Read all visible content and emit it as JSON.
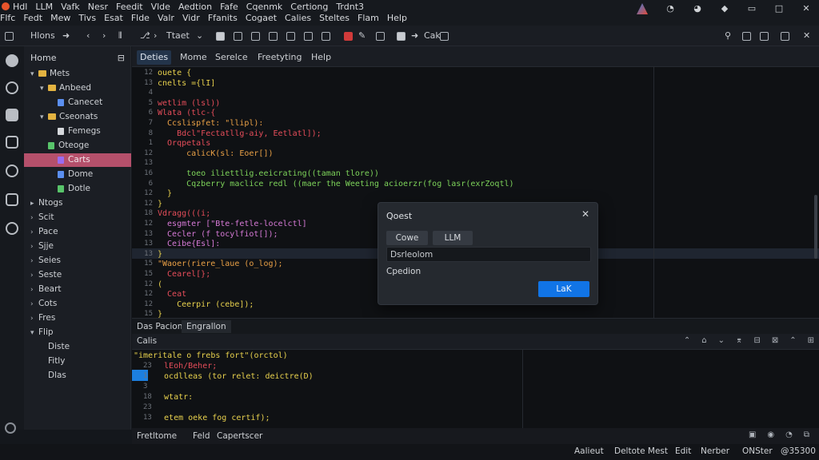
{
  "menu": {
    "row1": [
      "Hdl",
      "LLM",
      "Vafk",
      "Nesr",
      "Feedit",
      "Vlde",
      "Aedtion",
      "Fafe",
      "Cqenmk",
      "Certiong",
      "Trdnt3"
    ],
    "row2": [
      "Flfc",
      "Fedt",
      "Mew",
      "Tivs",
      "Esat",
      "Flde",
      "Valr",
      "Vidr",
      "Ffanits",
      "Cogaet",
      "Calies",
      "Steltes",
      "Flam",
      "Help"
    ]
  },
  "toolbar": {
    "home_label": "Hlons",
    "type_label": "Ttaet",
    "extra_label": "Cak",
    "icons": [
      "search-icon",
      "maximize-icon",
      "restore-icon",
      "close-icon"
    ]
  },
  "sidebar": {
    "title": "Home",
    "items": [
      {
        "label": "Mets",
        "level": 0,
        "chevron": "▾",
        "icon": "folder"
      },
      {
        "label": "Anbeed",
        "level": 1,
        "chevron": "▾",
        "icon": "folder"
      },
      {
        "label": "Canecet",
        "level": 2,
        "chevron": "",
        "icon": "file-blue"
      },
      {
        "label": "Cseonats",
        "level": 1,
        "chevron": "▾",
        "icon": "folder"
      },
      {
        "label": "Femegs",
        "level": 2,
        "chevron": "",
        "icon": "file-plain"
      },
      {
        "label": "Oteoge",
        "level": 1,
        "chevron": "",
        "icon": "file-green"
      },
      {
        "label": "Carts",
        "level": 2,
        "chevron": "",
        "icon": "file-purple",
        "selected": true
      },
      {
        "label": "Dome",
        "level": 2,
        "chevron": "",
        "icon": "file-blue"
      },
      {
        "label": "Dotle",
        "level": 2,
        "chevron": "",
        "icon": "file-green"
      },
      {
        "label": "Ntogs",
        "level": 0,
        "chevron": "▸",
        "icon": ""
      },
      {
        "label": "Scit",
        "level": 0,
        "chevron": "›",
        "icon": ""
      },
      {
        "label": "Pace",
        "level": 0,
        "chevron": "›",
        "icon": ""
      },
      {
        "label": "Sjje",
        "level": 0,
        "chevron": "›",
        "icon": ""
      },
      {
        "label": "Seies",
        "level": 0,
        "chevron": "›",
        "icon": ""
      },
      {
        "label": "Seste",
        "level": 0,
        "chevron": "›",
        "icon": ""
      },
      {
        "label": "Beart",
        "level": 0,
        "chevron": "›",
        "icon": ""
      },
      {
        "label": "Cots",
        "level": 0,
        "chevron": "›",
        "icon": ""
      },
      {
        "label": "Fres",
        "level": 0,
        "chevron": "›",
        "icon": ""
      },
      {
        "label": "Flip",
        "level": 0,
        "chevron": "▾",
        "icon": ""
      },
      {
        "label": "Diste",
        "level": 1,
        "chevron": "",
        "icon": ""
      },
      {
        "label": "Fitly",
        "level": 1,
        "chevron": "",
        "icon": ""
      },
      {
        "label": "Dlas",
        "level": 1,
        "chevron": "",
        "icon": ""
      }
    ]
  },
  "editor_tabs": [
    "Deties",
    "Mome",
    "Serelce",
    "Freetyting",
    "Help"
  ],
  "editor": {
    "line_numbers": [
      "12",
      "13",
      "4",
      "5",
      "6",
      "7",
      "8",
      "1",
      "12",
      "13",
      "16",
      "6",
      "12",
      "12",
      "18",
      "12",
      "13",
      "13",
      "13",
      "15",
      "15",
      "12",
      "12",
      "12",
      "15",
      "12",
      "18",
      "13",
      "13",
      "18"
    ],
    "lines": [
      {
        "t": "ouete {",
        "c": "fn"
      },
      {
        "t": "cnelts ={lI]",
        "c": "fn"
      },
      {
        "t": "",
        "c": "fn"
      },
      {
        "t": "wetlim (lsl))",
        "c": "kw"
      },
      {
        "t": "Wlata (tlc-{",
        "c": "kw"
      },
      {
        "t": "  Ccslispfet: \"llipl):",
        "c": "str"
      },
      {
        "t": "    Bdcl\"Fectatllg-aiy, Eetlatl]);",
        "c": "kw"
      },
      {
        "t": "  Orqpetals",
        "c": "kw"
      },
      {
        "t": "      calicK(sl: Eoer[])",
        "c": "str"
      },
      {
        "t": "",
        "c": "fn"
      },
      {
        "t": "      toeo iliettlig.eeicrating((taman tlore))",
        "c": "lg"
      },
      {
        "t": "      Cqzberry maclice redl ((maer the Weeting acioerzr(fog lasr(exrZoqtl)",
        "c": "lg"
      },
      {
        "t": "  }",
        "c": "fn"
      },
      {
        "t": "}",
        "c": "fn"
      },
      {
        "t": "Vdragg(((i;",
        "c": "kw"
      },
      {
        "t": "  esgmter [\"Bte-fetle-locelctl]",
        "c": "pl"
      },
      {
        "t": "  Cecler (f tocylfiot[]);",
        "c": "pl"
      },
      {
        "t": "  Ceibe{Esl]:",
        "c": "pl"
      },
      {
        "t": "}",
        "c": "fn"
      },
      {
        "t": "\"Waoer(riere_laue (o_log);",
        "c": "str"
      },
      {
        "t": "  Cearel[};",
        "c": "kw"
      },
      {
        "t": "(",
        "c": "fn"
      },
      {
        "t": "  Ceat",
        "c": "kw"
      },
      {
        "t": "    Ceerpir (cebe]);",
        "c": "fn"
      },
      {
        "t": "}",
        "c": "fn"
      }
    ]
  },
  "dialog": {
    "title": "Qoest",
    "tab1": "Cowe",
    "tab2": "LLM",
    "input_value": "Dsrleolom",
    "label": "Cpedion",
    "ok": "LaK"
  },
  "panel": {
    "tabs": [
      "Das Pacion",
      "Engrallon"
    ],
    "title": "Calis",
    "lines": [
      {
        "n": "",
        "t": "\"imeritale o frebs fort\"(orctol)",
        "c": "fn"
      },
      {
        "n": "23",
        "t": "  lEoh/Beher;",
        "c": "kw"
      },
      {
        "n": "1",
        "t": "  ocdlleas (tor relet: deictre(D)",
        "c": "fn"
      },
      {
        "n": "3",
        "t": "",
        "c": "fn"
      },
      {
        "n": "18",
        "t": "  wtatr:",
        "c": "fn"
      },
      {
        "n": "23",
        "t": "",
        "c": "fn"
      },
      {
        "n": "13",
        "t": "  etem oeke fog certif);",
        "c": "fn"
      }
    ]
  },
  "bottom_tabs": [
    "Fretltome",
    "Feld",
    "Capertscer"
  ],
  "status": {
    "items": [
      "Aalieut",
      "Deltote Mest",
      "Edit",
      "Nerber",
      "ONSter",
      "@35300"
    ]
  },
  "colors": {
    "accent": "#1174e6",
    "selection": "#b5506b",
    "keyword": "#e64d5a",
    "string": "#e9a046",
    "function": "#e8d14d",
    "log": "#7dd35a"
  }
}
